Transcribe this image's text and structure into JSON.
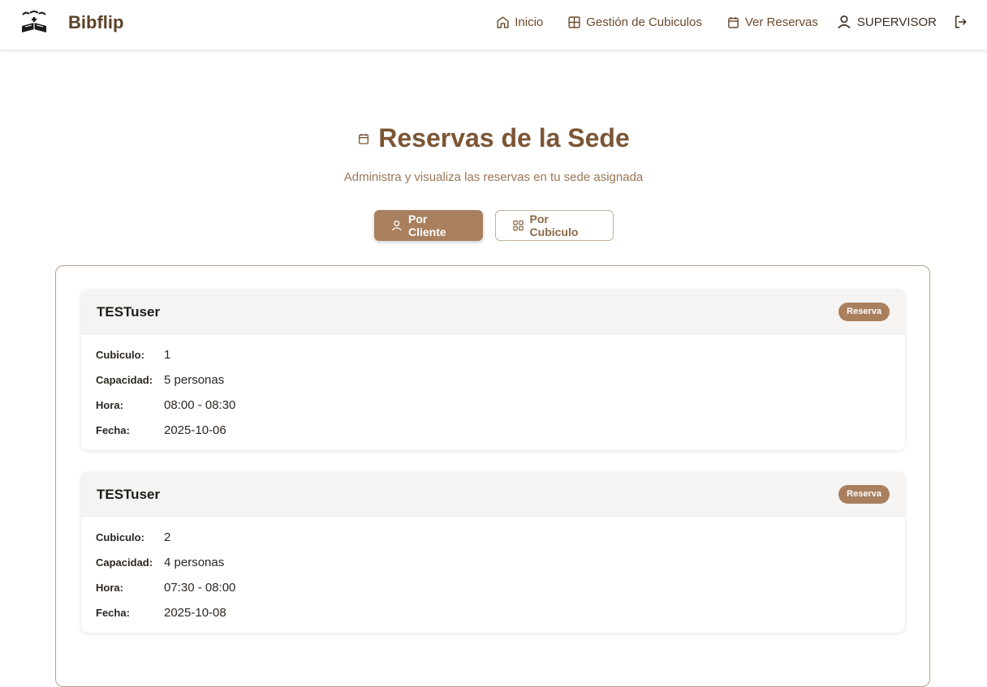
{
  "app": {
    "name": "Bibflip",
    "logo_icon": "open-book-logo-icon"
  },
  "nav": {
    "items": [
      {
        "label": "Inicio",
        "icon": "home-icon"
      },
      {
        "label": "Gestión de Cubiculos",
        "icon": "grid-icon"
      },
      {
        "label": "Ver Reservas",
        "icon": "calendar-icon"
      }
    ],
    "user_label": "SUPERVISOR",
    "user_icon": "user-icon",
    "logout_icon": "logout-icon"
  },
  "page": {
    "title": "Reservas de la Sede",
    "title_icon": "calendar-icon",
    "subtitle": "Administra y visualiza las reservas en tu sede asignada"
  },
  "tabs": [
    {
      "label": "Por Cliente",
      "icon": "user-icon",
      "active": true
    },
    {
      "label": "Por Cubiculo",
      "icon": "grid-icon",
      "active": false
    }
  ],
  "labels": {
    "cubiculo": "Cubiculo:",
    "capacidad": "Capacidad:",
    "hora": "Hora:",
    "fecha": "Fecha:"
  },
  "reservations": [
    {
      "name": "TESTuser",
      "badge": "Reserva",
      "cubiculo": "1",
      "capacidad": "5 personas",
      "hora": "08:00 - 08:30",
      "fecha": "2025-10-06"
    },
    {
      "name": "TESTuser",
      "badge": "Reserva",
      "cubiculo": "2",
      "capacidad": "4 personas",
      "hora": "07:30 - 08:00",
      "fecha": "2025-10-08"
    }
  ],
  "colors": {
    "accent": "#a97f5e",
    "title": "#7b5636",
    "brand_text": "#5b4127",
    "card_header": "#f6f4f2"
  }
}
